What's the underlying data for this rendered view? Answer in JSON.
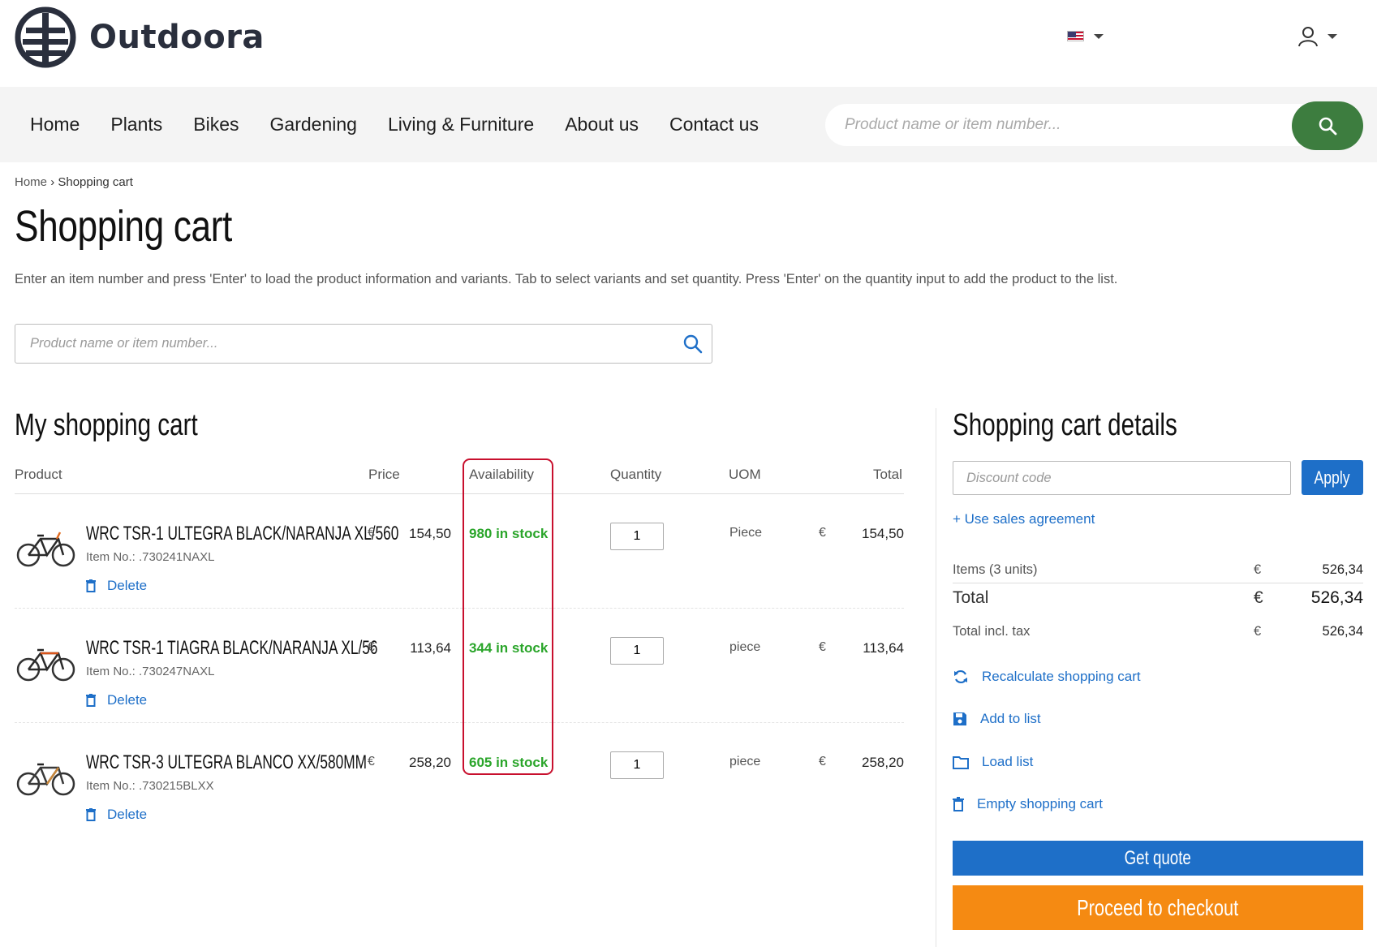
{
  "header": {
    "brand": "Outdoora",
    "logo_icon": "tree-logo-icon",
    "language_icon": "us-flag-icon",
    "account_icon": "user-icon"
  },
  "nav": {
    "items": [
      "Home",
      "Plants",
      "Bikes",
      "Gardening",
      "Living & Furniture",
      "About us",
      "Contact us"
    ],
    "search_placeholder": "Product name or item number...",
    "search_icon": "search-icon",
    "accent": "#3d7d3f"
  },
  "breadcrumb": {
    "home": "Home",
    "separator": "›",
    "current": "Shopping cart"
  },
  "page": {
    "title": "Shopping cart",
    "intro": "Enter an item number and press 'Enter' to load the product information and variants. Tab to select variants and set quantity. Press 'Enter' on the quantity input to add the product to the list.",
    "quick_search_placeholder": "Product name or item number..."
  },
  "cart": {
    "title": "My shopping cart",
    "columns": {
      "product": "Product",
      "price": "Price",
      "availability": "Availability",
      "quantity": "Quantity",
      "uom": "UOM",
      "total": "Total"
    },
    "delete_label": "Delete",
    "currency": "€",
    "items": [
      {
        "name": "WRC TSR-1 ULTEGRA BLACK/NARANJA XL/560",
        "item_no": "Item No.: .730241NAXL",
        "price": "154,50",
        "stock": "980 in stock",
        "qty": "1",
        "uom": "Piece",
        "total": "154,50",
        "frame_color": "#2b2b2b",
        "accent_color": "#e06a1f"
      },
      {
        "name": "WRC TSR-1 TIAGRA BLACK/NARANJA XL/56",
        "item_no": "Item No.: .730247NAXL",
        "price": "113,64",
        "stock": "344 in stock",
        "qty": "1",
        "uom": "piece",
        "total": "113,64",
        "frame_color": "#2b2b2b",
        "accent_color": "#d9541a"
      },
      {
        "name": "WRC TSR-3 ULTEGRA BLANCO XX/580MM",
        "item_no": "Item No.: .730215BLXX",
        "price": "258,20",
        "stock": "605 in stock",
        "qty": "1",
        "uom": "piece",
        "total": "258,20",
        "frame_color": "#3a3a3a",
        "accent_color": "#c9873a"
      }
    ],
    "highlight_color": "#c8102e",
    "stock_color": "#2aa52a"
  },
  "details": {
    "title": "Shopping cart details",
    "discount_placeholder": "Discount code",
    "apply_label": "Apply",
    "sales_agreement": "+ Use sales agreement",
    "currency": "€",
    "items_label": "Items (3 units)",
    "items_amount": "526,34",
    "total_label": "Total",
    "total_amount": "526,34",
    "total_tax_label": "Total incl. tax",
    "total_tax_amount": "526,34",
    "actions": [
      {
        "label": "Recalculate shopping cart",
        "icon": "refresh-icon"
      },
      {
        "label": "Add to list",
        "icon": "save-icon"
      },
      {
        "label": "Load list",
        "icon": "folder-icon"
      },
      {
        "label": "Empty shopping cart",
        "icon": "trash-icon"
      }
    ],
    "quote_label": "Get quote",
    "checkout_label": "Proceed to checkout",
    "primary_color": "#1e6fc8",
    "checkout_color": "#f58a12"
  }
}
